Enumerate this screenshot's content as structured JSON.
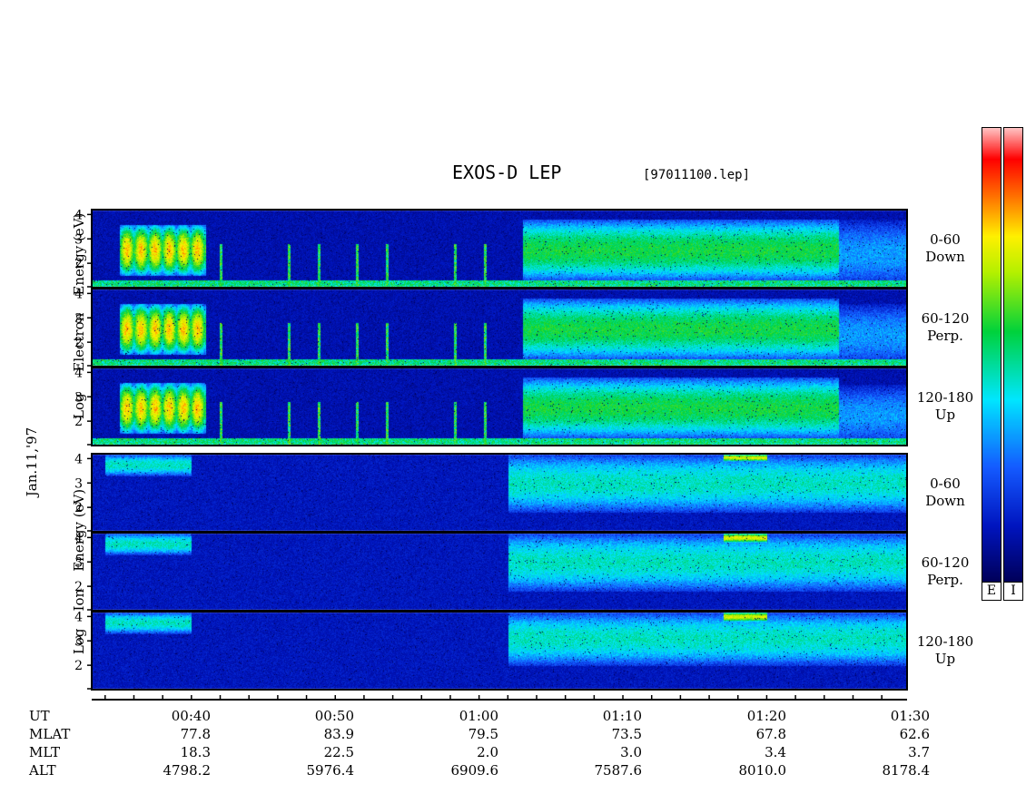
{
  "header": {
    "title": "EXOS-D LEP",
    "filename": "[97011100.lep]"
  },
  "date_label": "Jan.11,'97",
  "electron_axis_label": [
    "Log",
    "Electron",
    "Energy",
    "(eV)"
  ],
  "ion_axis_label": [
    "Log",
    "Ion",
    "Energy",
    "(eV)"
  ],
  "panels": [
    {
      "species": "Electron",
      "pitch_range": "0-60",
      "direction": "Down"
    },
    {
      "species": "Electron",
      "pitch_range": "60-120",
      "direction": "Perp."
    },
    {
      "species": "Electron",
      "pitch_range": "120-180",
      "direction": "Up"
    },
    {
      "species": "Ion",
      "pitch_range": "0-60",
      "direction": "Down"
    },
    {
      "species": "Ion",
      "pitch_range": "60-120",
      "direction": "Perp."
    },
    {
      "species": "Ion",
      "pitch_range": "120-180",
      "direction": "Up"
    }
  ],
  "y_ticks": [
    "2",
    "3",
    "4"
  ],
  "colorbar": {
    "labels": [
      "E",
      "I"
    ],
    "colors": [
      "#ffffff",
      "#ff9090",
      "#ff0000",
      "#ff8000",
      "#ffff00",
      "#00d000",
      "#00ffff",
      "#2060ff",
      "#0000a0",
      "#000060"
    ]
  },
  "ephemeris": {
    "headers": [
      "UT",
      "MLAT",
      "MLT",
      "ALT"
    ],
    "columns": [
      {
        "UT": "00:40",
        "MLAT": "77.8",
        "MLT": "18.3",
        "ALT": "4798.2"
      },
      {
        "UT": "00:50",
        "MLAT": "83.9",
        "MLT": "22.5",
        "ALT": "5976.4"
      },
      {
        "UT": "01:00",
        "MLAT": "79.5",
        "MLT": "2.0",
        "ALT": "6909.6"
      },
      {
        "UT": "01:10",
        "MLAT": "73.5",
        "MLT": "3.0",
        "ALT": "7587.6"
      },
      {
        "UT": "01:20",
        "MLAT": "67.8",
        "MLT": "3.4",
        "ALT": "8010.0"
      },
      {
        "UT": "01:30",
        "MLAT": "62.6",
        "MLT": "3.7",
        "ALT": "8178.4"
      }
    ]
  },
  "chart_data": {
    "type": "heatmap",
    "title": "EXOS-D LEP",
    "xlabel": "UT",
    "ylabel": "Log Energy (eV)",
    "x_ticks": [
      "00:40",
      "00:50",
      "01:00",
      "01:10",
      "01:20",
      "01:30"
    ],
    "xlim": [
      "00:35",
      "01:32"
    ],
    "ylim": [
      1,
      4.2
    ],
    "y_ticks": [
      2,
      3,
      4
    ],
    "colormap": "blue-cyan-green-yellow-red-white (low to high)",
    "panels": [
      {
        "species": "Electron",
        "pitch_angle": "0-60",
        "direction": "Down",
        "features": [
          {
            "t_start": "00:36",
            "t_end": "00:42",
            "log_e_range": [
              1.5,
              3.6
            ],
            "intensity": "high"
          },
          {
            "t_start": "01:04",
            "t_end": "01:26",
            "log_e_range": [
              1.3,
              3.8
            ],
            "intensity": "medium-high"
          },
          {
            "t_start": "01:26",
            "t_end": "01:32",
            "log_e_range": [
              1.0,
              3.8
            ],
            "intensity": "low"
          }
        ]
      },
      {
        "species": "Electron",
        "pitch_angle": "60-120",
        "direction": "Perp.",
        "features": [
          {
            "t_start": "00:36",
            "t_end": "00:42",
            "log_e_range": [
              1.5,
              3.6
            ],
            "intensity": "high"
          },
          {
            "t_start": "01:04",
            "t_end": "01:26",
            "log_e_range": [
              1.3,
              3.8
            ],
            "intensity": "medium-high"
          },
          {
            "t_start": "01:26",
            "t_end": "01:32",
            "log_e_range": [
              1.0,
              3.6
            ],
            "intensity": "low"
          }
        ]
      },
      {
        "species": "Electron",
        "pitch_angle": "120-180",
        "direction": "Up",
        "features": [
          {
            "t_start": "00:36",
            "t_end": "00:42",
            "log_e_range": [
              1.5,
              3.6
            ],
            "intensity": "high"
          },
          {
            "t_start": "01:04",
            "t_end": "01:26",
            "log_e_range": [
              1.3,
              3.8
            ],
            "intensity": "medium-high"
          },
          {
            "t_start": "01:26",
            "t_end": "01:32",
            "log_e_range": [
              1.0,
              3.5
            ],
            "intensity": "low"
          }
        ]
      },
      {
        "species": "Ion",
        "pitch_angle": "0-60",
        "direction": "Down",
        "features": [
          {
            "t_start": "00:35",
            "t_end": "00:41",
            "log_e_range": [
              3.3,
              4.2
            ],
            "intensity": "medium"
          },
          {
            "t_start": "01:03",
            "t_end": "01:32",
            "log_e_range": [
              1.8,
              4.2
            ],
            "intensity": "medium"
          },
          {
            "t_start": "01:18",
            "t_end": "01:21",
            "log_e_range": [
              3.9,
              4.2
            ],
            "intensity": "high"
          }
        ]
      },
      {
        "species": "Ion",
        "pitch_angle": "60-120",
        "direction": "Perp.",
        "features": [
          {
            "t_start": "00:35",
            "t_end": "00:41",
            "log_e_range": [
              3.3,
              4.2
            ],
            "intensity": "medium"
          },
          {
            "t_start": "01:03",
            "t_end": "01:32",
            "log_e_range": [
              1.8,
              4.2
            ],
            "intensity": "medium"
          },
          {
            "t_start": "01:18",
            "t_end": "01:21",
            "log_e_range": [
              3.8,
              4.2
            ],
            "intensity": "high"
          }
        ]
      },
      {
        "species": "Ion",
        "pitch_angle": "120-180",
        "direction": "Up",
        "features": [
          {
            "t_start": "00:35",
            "t_end": "00:41",
            "log_e_range": [
              3.3,
              4.2
            ],
            "intensity": "medium"
          },
          {
            "t_start": "01:03",
            "t_end": "01:32",
            "log_e_range": [
              2.0,
              4.2
            ],
            "intensity": "medium"
          },
          {
            "t_start": "01:18",
            "t_end": "01:21",
            "log_e_range": [
              3.8,
              4.2
            ],
            "intensity": "high"
          }
        ]
      }
    ]
  }
}
